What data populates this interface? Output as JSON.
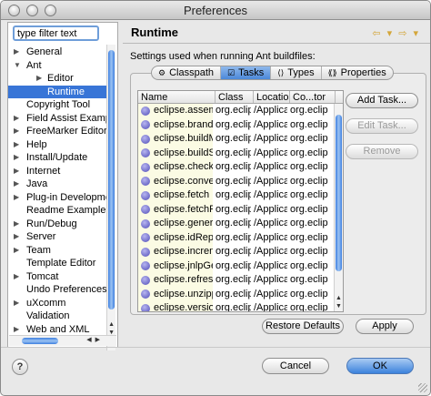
{
  "window": {
    "title": "Preferences"
  },
  "sidebar": {
    "filter_placeholder": "type filter text",
    "items": [
      {
        "label": "General",
        "expander": "▶"
      },
      {
        "label": "Ant",
        "expander": "▼"
      },
      {
        "label": "Editor",
        "expander": "▶"
      },
      {
        "label": "Runtime",
        "expander": ""
      },
      {
        "label": "Copyright Tool",
        "expander": ""
      },
      {
        "label": "Field Assist Examp",
        "expander": "▶"
      },
      {
        "label": "FreeMarker Editor",
        "expander": "▶"
      },
      {
        "label": "Help",
        "expander": "▶"
      },
      {
        "label": "Install/Update",
        "expander": "▶"
      },
      {
        "label": "Internet",
        "expander": "▶"
      },
      {
        "label": "Java",
        "expander": "▶"
      },
      {
        "label": "Plug-in Developme",
        "expander": "▶"
      },
      {
        "label": "Readme Example",
        "expander": ""
      },
      {
        "label": "Run/Debug",
        "expander": "▶"
      },
      {
        "label": "Server",
        "expander": "▶"
      },
      {
        "label": "Team",
        "expander": "▶"
      },
      {
        "label": "Template Editor",
        "expander": ""
      },
      {
        "label": "Tomcat",
        "expander": "▶"
      },
      {
        "label": "Undo Preferences",
        "expander": ""
      },
      {
        "label": "uXcomm",
        "expander": "▶"
      },
      {
        "label": "Validation",
        "expander": ""
      },
      {
        "label": "Web and XML",
        "expander": "▶"
      }
    ]
  },
  "main": {
    "title": "Runtime",
    "nav_arrows": "⇦ ▾ ⇨ ▾",
    "description": "Settings used when running Ant buildfiles:",
    "tabs": [
      {
        "label": "Classpath",
        "icon": "⚙"
      },
      {
        "label": "Tasks",
        "icon": "☑"
      },
      {
        "label": "Types",
        "icon": "⟨⟩"
      },
      {
        "label": "Properties",
        "icon": "⟪⟫"
      }
    ],
    "table": {
      "columns": [
        "Name",
        "Class",
        "Location",
        "Co...tor"
      ],
      "rows": [
        {
          "name": "eclipse.assemb",
          "class": "org.eclips",
          "location": "/Applicat",
          "contributor": "org.eclip"
        },
        {
          "name": "eclipse.brand",
          "class": "org.eclips",
          "location": "/Applicat",
          "contributor": "org.eclip"
        },
        {
          "name": "eclipse.buildMa",
          "class": "org.eclips",
          "location": "/Applicat",
          "contributor": "org.eclip"
        },
        {
          "name": "eclipse.buildSc",
          "class": "org.eclips",
          "location": "/Applicat",
          "contributor": "org.eclip"
        },
        {
          "name": "eclipse.checkD",
          "class": "org.eclips",
          "location": "/Applicat",
          "contributor": "org.eclip"
        },
        {
          "name": "eclipse.convert",
          "class": "org.eclips",
          "location": "/Applicat",
          "contributor": "org.eclip"
        },
        {
          "name": "eclipse.fetch",
          "class": "org.eclips",
          "location": "/Applicat",
          "contributor": "org.eclip"
        },
        {
          "name": "eclipse.fetchFil",
          "class": "org.eclips",
          "location": "/Applicat",
          "contributor": "org.eclip"
        },
        {
          "name": "eclipse.generat",
          "class": "org.eclips",
          "location": "/Applicat",
          "contributor": "org.eclip"
        },
        {
          "name": "eclipse.idRepla",
          "class": "org.eclips",
          "location": "/Applicat",
          "contributor": "org.eclip"
        },
        {
          "name": "eclipse.increm",
          "class": "org.eclips",
          "location": "/Applicat",
          "contributor": "org.eclip"
        },
        {
          "name": "eclipse.jnlpGen",
          "class": "org.eclips",
          "location": "/Applicat",
          "contributor": "org.eclip"
        },
        {
          "name": "eclipse.refresh",
          "class": "org.eclips",
          "location": "/Applicat",
          "contributor": "org.eclip"
        },
        {
          "name": "eclipse.unzipp",
          "class": "org.eclips",
          "location": "/Applicat",
          "contributor": "org.eclip"
        },
        {
          "name": "eclipse.version",
          "class": "org.eclips",
          "location": "/Applicat",
          "contributor": "org.eclip"
        }
      ]
    },
    "buttons": {
      "add_task": "Add Task...",
      "edit_task": "Edit Task...",
      "remove": "Remove",
      "restore_defaults": "Restore Defaults",
      "apply": "Apply"
    }
  },
  "footer": {
    "help": "?",
    "cancel": "Cancel",
    "ok": "OK"
  }
}
